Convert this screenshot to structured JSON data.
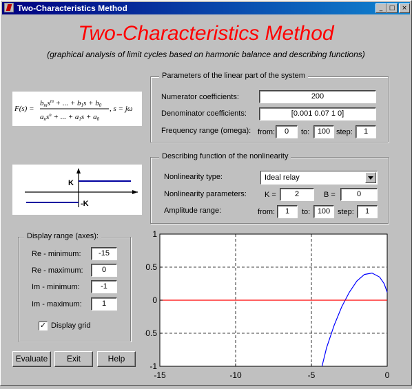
{
  "window": {
    "title": "Two-Characteristics Method",
    "buttons": {
      "minimize": "_",
      "maximize": "□",
      "close": "×"
    }
  },
  "header": {
    "title": "Two-Characteristics Method",
    "subtitle": "(graphical analysis of limit cycles based on harmonic balance and describing functions)"
  },
  "linear": {
    "group_title": "Parameters of the linear part of the system",
    "numerator_label": "Numerator coefficients:",
    "numerator_value": "200",
    "denominator_label": "Denominator coefficients:",
    "denominator_value": "[0.001 0.07 1 0]",
    "freq_label": "Frequency range (omega):",
    "from_label": "from:",
    "from_value": "0",
    "to_label": "to:",
    "to_value": "100",
    "step_label": "step:",
    "step_value": "1"
  },
  "formula": {
    "lhs": "F(s) =",
    "num": "b",
    "s_eq": ", s = jω"
  },
  "nonlinear": {
    "group_title": "Describing function of the nonlinearity",
    "type_label": "Nonlinearity type:",
    "type_value": "Ideal relay",
    "params_label": "Nonlinearity parameters:",
    "k_label": "K =",
    "k_value": "2",
    "b_label": "B =",
    "b_value": "0",
    "amp_label": "Amplitude range:",
    "from_label": "from:",
    "from_value": "1",
    "to_label": "to:",
    "to_value": "100",
    "step_label": "step:",
    "step_value": "1",
    "diagram_k": "K",
    "diagram_neg_k": "-K"
  },
  "display": {
    "group_title": "Display range (axes):",
    "re_min_label": "Re - minimum:",
    "re_min": "-15",
    "re_max_label": "Re - maximum:",
    "re_max": "0",
    "im_min_label": "Im - minimum:",
    "im_min": "-1",
    "im_max_label": "Im - maximum:",
    "im_max": "1",
    "grid_label": "Display grid",
    "grid_checked": "✓"
  },
  "actions": {
    "evaluate": "Evaluate",
    "exit": "Exit",
    "help": "Help"
  },
  "chart_data": {
    "type": "line",
    "xlim": [
      -15,
      0
    ],
    "ylim": [
      -1,
      1
    ],
    "x_ticks": [
      "-15",
      "-10",
      "-5",
      "0"
    ],
    "y_ticks": [
      "1",
      "0.5",
      "0",
      "-0.5",
      "-1"
    ],
    "grid": true,
    "colors": {
      "nyquist": "#0000ff",
      "nonlinearity": "#ff0000"
    },
    "series": [
      {
        "x": [
          -4.3,
          -4.0,
          -3.5,
          -3.0,
          -2.5,
          -2.0,
          -1.5,
          -1.0,
          -0.5,
          -0.2,
          0
        ],
        "y": [
          -1.0,
          -0.72,
          -0.38,
          -0.1,
          0.12,
          0.29,
          0.39,
          0.41,
          0.35,
          0.25,
          0.12
        ]
      },
      {
        "x": [
          -15,
          0
        ],
        "y": [
          0,
          0
        ]
      }
    ]
  }
}
